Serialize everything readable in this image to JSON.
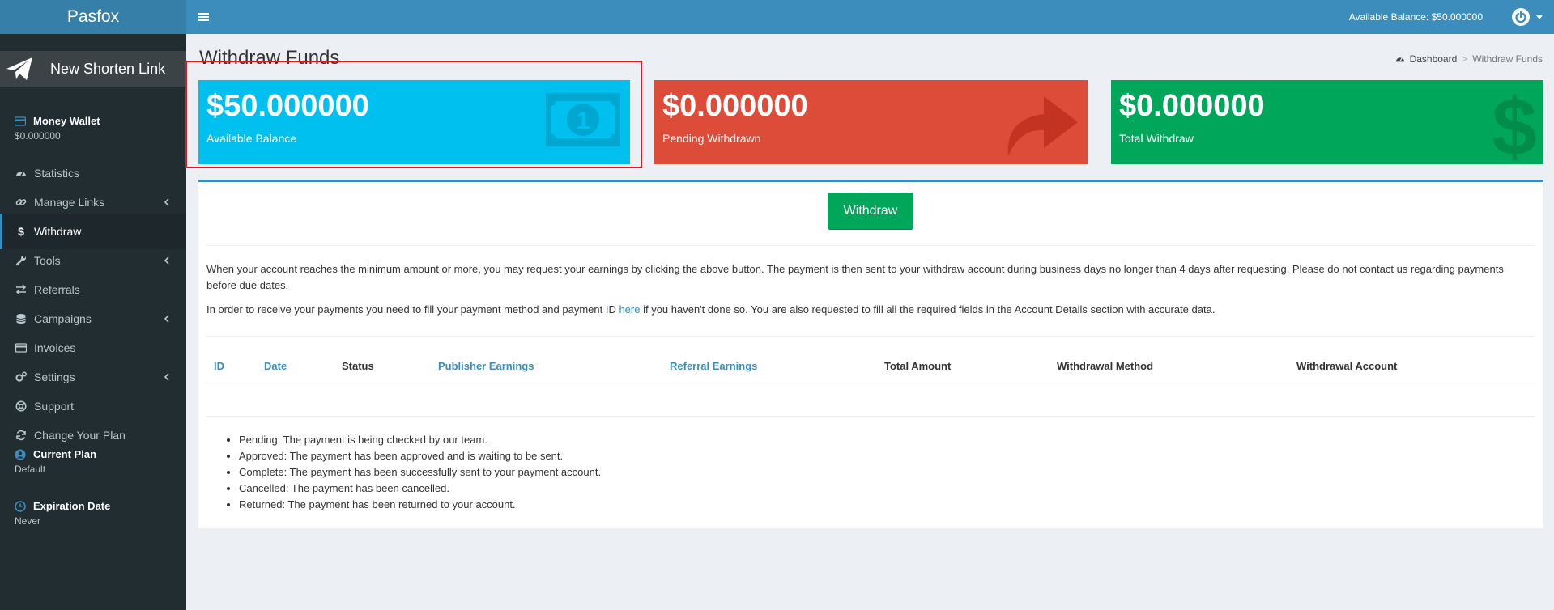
{
  "header": {
    "logo": "Pasfox",
    "balance_text": "Available Balance: $50.000000"
  },
  "sidebar": {
    "new_link_label": "New Shorten Link",
    "wallet": {
      "title": "Money Wallet",
      "value": "$0.000000"
    },
    "items": [
      {
        "label": "Statistics",
        "icon": "dashboard-icon"
      },
      {
        "label": "Manage Links",
        "icon": "link-icon"
      },
      {
        "label": "Withdraw",
        "icon": "dollar-icon"
      },
      {
        "label": "Tools",
        "icon": "wrench-icon"
      },
      {
        "label": "Referrals",
        "icon": "exchange-icon"
      },
      {
        "label": "Campaigns",
        "icon": "database-icon"
      },
      {
        "label": "Invoices",
        "icon": "credit-card-icon"
      },
      {
        "label": "Settings",
        "icon": "gears-icon"
      },
      {
        "label": "Support",
        "icon": "life-ring-icon"
      },
      {
        "label": "Change Your Plan",
        "icon": "refresh-icon"
      }
    ],
    "current_plan": {
      "title": "Current Plan",
      "value": "Default"
    },
    "expiration": {
      "title": "Expiration Date",
      "value": "Never"
    }
  },
  "page": {
    "title": "Withdraw Funds",
    "breadcrumb": {
      "home": "Dashboard",
      "sep": ">",
      "current": "Withdraw Funds"
    }
  },
  "boxes": {
    "available": {
      "amount": "$50.000000",
      "label": "Available Balance",
      "color": "#00c0ef"
    },
    "pending": {
      "amount": "$0.000000",
      "label": "Pending Withdrawn",
      "color": "#dd4b39"
    },
    "total": {
      "amount": "$0.000000",
      "label": "Total Withdraw",
      "color": "#00a65a"
    }
  },
  "panel": {
    "withdraw_button": "Withdraw",
    "para1": "When your account reaches the minimum amount or more, you may request your earnings by clicking the above button. The payment is then sent to your withdraw account during business days no longer than 4 days after requesting. Please do not contact us regarding payments before due dates.",
    "para2_before": "In order to receive your payments you need to fill your payment method and payment ID ",
    "para2_link": "here",
    "para2_after": " if you haven't done so. You are also requested to fill all the required fields in the Account Details section with accurate data.",
    "columns": [
      "ID",
      "Date",
      "Status",
      "Publisher Earnings",
      "Referral Earnings",
      "Total Amount",
      "Withdrawal Method",
      "Withdrawal Account"
    ],
    "legend": [
      "Pending: The payment is being checked by our team.",
      "Approved: The payment has been approved and is waiting to be sent.",
      "Complete: The payment has been successfully sent to your payment account.",
      "Cancelled: The payment has been cancelled.",
      "Returned: The payment has been returned to your account."
    ]
  }
}
